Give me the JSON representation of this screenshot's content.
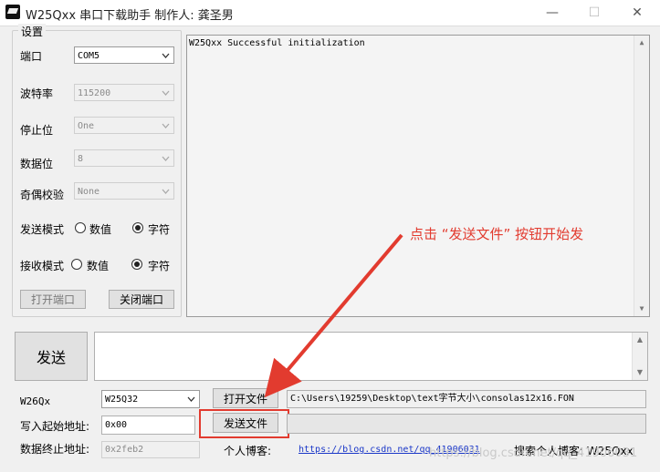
{
  "window": {
    "title": "W25Qxx   串口下载助手   制作人: 龚圣男",
    "minimize": "—",
    "maximize": "☐",
    "close": "✕"
  },
  "settings": {
    "group_label": "设置",
    "port": {
      "label": "端口",
      "value": "COM5"
    },
    "baud": {
      "label": "波特率",
      "value": "115200"
    },
    "stopbits": {
      "label": "停止位",
      "value": "One"
    },
    "databits": {
      "label": "数据位",
      "value": "8"
    },
    "parity": {
      "label": "奇偶校验",
      "value": "None"
    },
    "send_mode": {
      "label": "发送模式",
      "opt1": "数值",
      "opt2": "字符"
    },
    "recv_mode": {
      "label": "接收模式",
      "opt1": "数值",
      "opt2": "字符"
    },
    "open_port": "打开端口",
    "close_port": "关闭端口"
  },
  "receive": {
    "text": "W25Qxx Successful initialization"
  },
  "send": {
    "button": "发送",
    "text": ""
  },
  "bottom": {
    "chip_label": "W26Qx",
    "chip_value": "W25Q32",
    "open_file": "打开文件",
    "file_path": "C:\\Users\\19259\\Desktop\\text字节大小\\consolas12x16.FON",
    "start_addr_label": "写入起始地址:",
    "start_addr_value": "0x00",
    "send_file": "发送文件",
    "end_addr_label": "数据终止地址:",
    "end_addr_value": "0x2feb2",
    "blog_label": "个人博客:",
    "blog_url": "https://blog.csdn.net/qq_41906031",
    "search_label": "搜索个人博客: W25Qxx"
  },
  "annotation": {
    "text": "点击 “发送文件” 按钮开始发"
  },
  "watermark": {
    "text": "https://blog.csdn.net/qq_41906031"
  },
  "colors": {
    "annotation": "#e23b2f",
    "link": "#1a37c8"
  }
}
